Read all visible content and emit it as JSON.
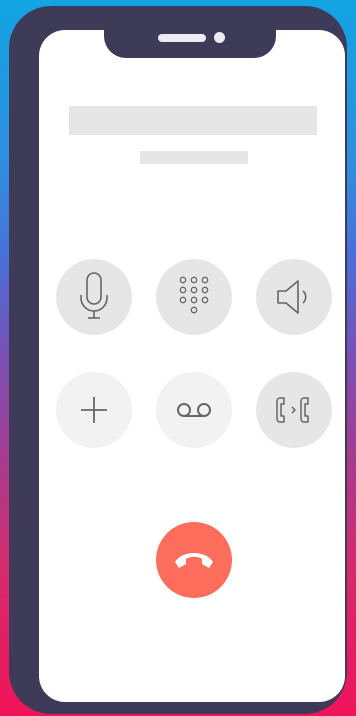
{
  "device": {
    "frame_color": "#3e3b58",
    "screen_color": "#ffffff"
  },
  "call": {
    "caller_name": "",
    "call_status": "",
    "end_call_color": "#fd6d5b"
  },
  "controls": [
    {
      "name": "mute",
      "icon": "microphone-icon"
    },
    {
      "name": "keypad",
      "icon": "keypad-icon"
    },
    {
      "name": "speaker",
      "icon": "speaker-icon"
    },
    {
      "name": "add-call",
      "icon": "plus-icon"
    },
    {
      "name": "voicemail",
      "icon": "voicemail-icon"
    },
    {
      "name": "swap-call",
      "icon": "swap-call-icon"
    }
  ]
}
